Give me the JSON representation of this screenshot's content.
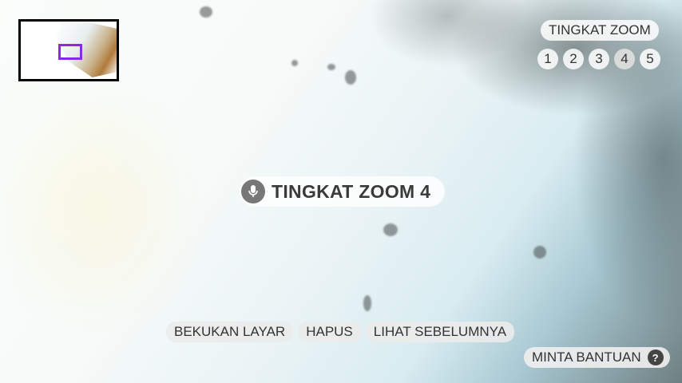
{
  "zoom": {
    "title": "TINGKAT ZOOM",
    "levels": [
      "1",
      "2",
      "3",
      "4",
      "5"
    ],
    "current_level": 4,
    "status_label": "TINGKAT ZOOM 4"
  },
  "actions": {
    "freeze": "BEKUKAN LAYAR",
    "delete": "HAPUS",
    "previous": "LIHAT SEBELUMNYA"
  },
  "help": {
    "label": "MINTA BANTUAN",
    "icon_glyph": "?"
  },
  "colors": {
    "minimap_viewport": "#8a2be2",
    "minimap_border": "#000000"
  },
  "icons": {
    "status": "microphone-icon",
    "help": "question-icon"
  }
}
